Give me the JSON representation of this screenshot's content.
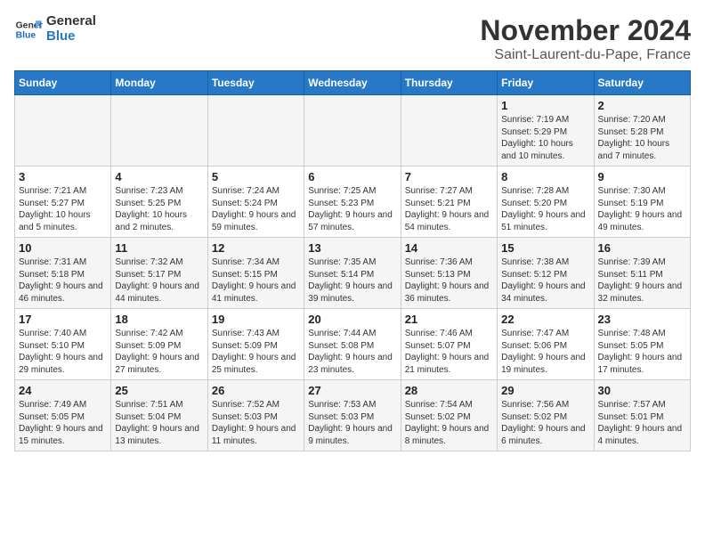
{
  "header": {
    "logo_line1": "General",
    "logo_line2": "Blue",
    "month": "November 2024",
    "location": "Saint-Laurent-du-Pape, France"
  },
  "weekdays": [
    "Sunday",
    "Monday",
    "Tuesday",
    "Wednesday",
    "Thursday",
    "Friday",
    "Saturday"
  ],
  "weeks": [
    [
      {
        "day": "",
        "info": ""
      },
      {
        "day": "",
        "info": ""
      },
      {
        "day": "",
        "info": ""
      },
      {
        "day": "",
        "info": ""
      },
      {
        "day": "",
        "info": ""
      },
      {
        "day": "1",
        "info": "Sunrise: 7:19 AM\nSunset: 5:29 PM\nDaylight: 10 hours and 10 minutes."
      },
      {
        "day": "2",
        "info": "Sunrise: 7:20 AM\nSunset: 5:28 PM\nDaylight: 10 hours and 7 minutes."
      }
    ],
    [
      {
        "day": "3",
        "info": "Sunrise: 7:21 AM\nSunset: 5:27 PM\nDaylight: 10 hours and 5 minutes."
      },
      {
        "day": "4",
        "info": "Sunrise: 7:23 AM\nSunset: 5:25 PM\nDaylight: 10 hours and 2 minutes."
      },
      {
        "day": "5",
        "info": "Sunrise: 7:24 AM\nSunset: 5:24 PM\nDaylight: 9 hours and 59 minutes."
      },
      {
        "day": "6",
        "info": "Sunrise: 7:25 AM\nSunset: 5:23 PM\nDaylight: 9 hours and 57 minutes."
      },
      {
        "day": "7",
        "info": "Sunrise: 7:27 AM\nSunset: 5:21 PM\nDaylight: 9 hours and 54 minutes."
      },
      {
        "day": "8",
        "info": "Sunrise: 7:28 AM\nSunset: 5:20 PM\nDaylight: 9 hours and 51 minutes."
      },
      {
        "day": "9",
        "info": "Sunrise: 7:30 AM\nSunset: 5:19 PM\nDaylight: 9 hours and 49 minutes."
      }
    ],
    [
      {
        "day": "10",
        "info": "Sunrise: 7:31 AM\nSunset: 5:18 PM\nDaylight: 9 hours and 46 minutes."
      },
      {
        "day": "11",
        "info": "Sunrise: 7:32 AM\nSunset: 5:17 PM\nDaylight: 9 hours and 44 minutes."
      },
      {
        "day": "12",
        "info": "Sunrise: 7:34 AM\nSunset: 5:15 PM\nDaylight: 9 hours and 41 minutes."
      },
      {
        "day": "13",
        "info": "Sunrise: 7:35 AM\nSunset: 5:14 PM\nDaylight: 9 hours and 39 minutes."
      },
      {
        "day": "14",
        "info": "Sunrise: 7:36 AM\nSunset: 5:13 PM\nDaylight: 9 hours and 36 minutes."
      },
      {
        "day": "15",
        "info": "Sunrise: 7:38 AM\nSunset: 5:12 PM\nDaylight: 9 hours and 34 minutes."
      },
      {
        "day": "16",
        "info": "Sunrise: 7:39 AM\nSunset: 5:11 PM\nDaylight: 9 hours and 32 minutes."
      }
    ],
    [
      {
        "day": "17",
        "info": "Sunrise: 7:40 AM\nSunset: 5:10 PM\nDaylight: 9 hours and 29 minutes."
      },
      {
        "day": "18",
        "info": "Sunrise: 7:42 AM\nSunset: 5:09 PM\nDaylight: 9 hours and 27 minutes."
      },
      {
        "day": "19",
        "info": "Sunrise: 7:43 AM\nSunset: 5:09 PM\nDaylight: 9 hours and 25 minutes."
      },
      {
        "day": "20",
        "info": "Sunrise: 7:44 AM\nSunset: 5:08 PM\nDaylight: 9 hours and 23 minutes."
      },
      {
        "day": "21",
        "info": "Sunrise: 7:46 AM\nSunset: 5:07 PM\nDaylight: 9 hours and 21 minutes."
      },
      {
        "day": "22",
        "info": "Sunrise: 7:47 AM\nSunset: 5:06 PM\nDaylight: 9 hours and 19 minutes."
      },
      {
        "day": "23",
        "info": "Sunrise: 7:48 AM\nSunset: 5:05 PM\nDaylight: 9 hours and 17 minutes."
      }
    ],
    [
      {
        "day": "24",
        "info": "Sunrise: 7:49 AM\nSunset: 5:05 PM\nDaylight: 9 hours and 15 minutes."
      },
      {
        "day": "25",
        "info": "Sunrise: 7:51 AM\nSunset: 5:04 PM\nDaylight: 9 hours and 13 minutes."
      },
      {
        "day": "26",
        "info": "Sunrise: 7:52 AM\nSunset: 5:03 PM\nDaylight: 9 hours and 11 minutes."
      },
      {
        "day": "27",
        "info": "Sunrise: 7:53 AM\nSunset: 5:03 PM\nDaylight: 9 hours and 9 minutes."
      },
      {
        "day": "28",
        "info": "Sunrise: 7:54 AM\nSunset: 5:02 PM\nDaylight: 9 hours and 8 minutes."
      },
      {
        "day": "29",
        "info": "Sunrise: 7:56 AM\nSunset: 5:02 PM\nDaylight: 9 hours and 6 minutes."
      },
      {
        "day": "30",
        "info": "Sunrise: 7:57 AM\nSunset: 5:01 PM\nDaylight: 9 hours and 4 minutes."
      }
    ]
  ]
}
